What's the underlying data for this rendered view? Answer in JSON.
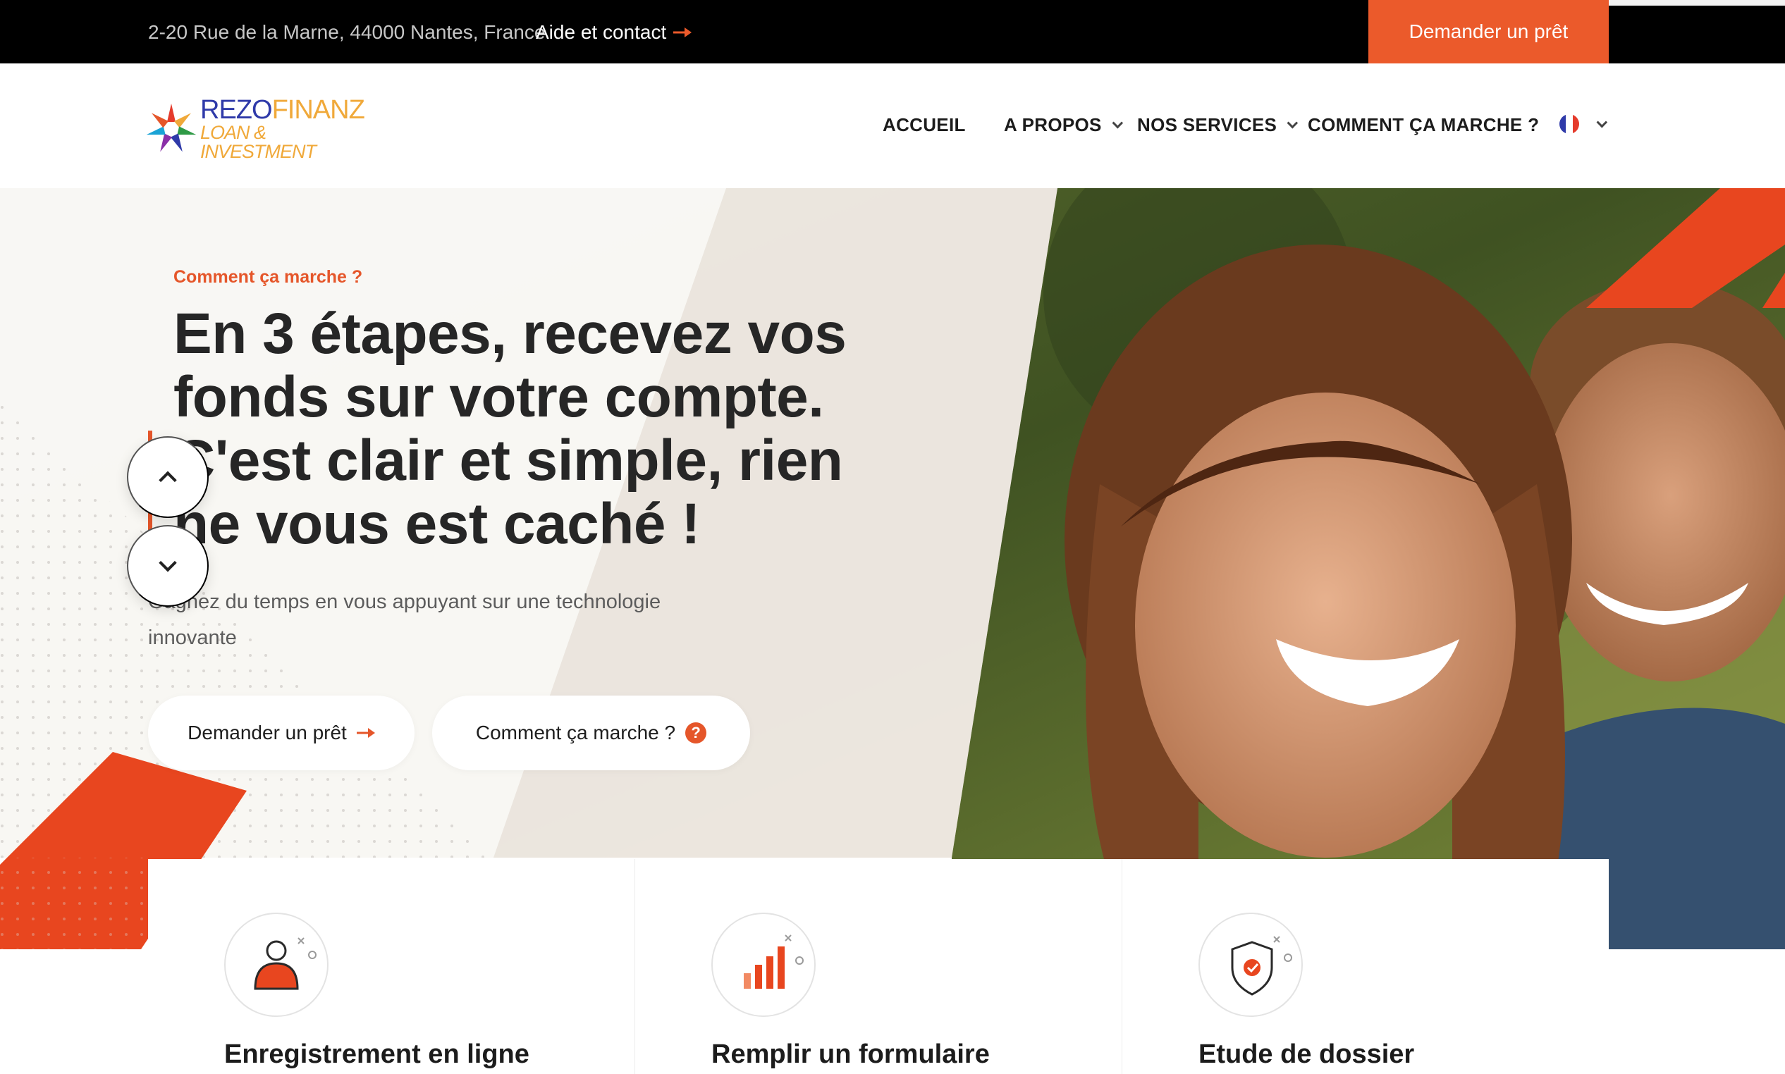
{
  "topbar": {
    "address": "2-20 Rue de la Marne, 44000 Nantes, France",
    "contact_label": "Aide et contact",
    "contact_icon": "arrow-right-icon",
    "cta_label": "Demander un prêt"
  },
  "brand": {
    "name_part1": "REZO",
    "name_part2": "FINANZ",
    "tagline": "LOAN & INVESTMENT",
    "colors": {
      "blue": "#2f3aa9",
      "gold": "#f0a93a"
    }
  },
  "nav": {
    "items": [
      {
        "label": "ACCUEIL",
        "has_dropdown": false
      },
      {
        "label": "A PROPOS",
        "has_dropdown": true
      },
      {
        "label": "NOS SERVICES",
        "has_dropdown": true
      },
      {
        "label": "COMMENT ÇA MARCHE ?",
        "has_dropdown": false
      }
    ],
    "language_icon": "france-flag-icon"
  },
  "hero": {
    "kicker": "Comment ça marche ?",
    "title": "En 3 étapes, recevez vos fonds sur votre compte. C'est clair et simple, rien ne vous est caché !",
    "subtitle": "Gagnez du temps en vous appuyant sur une technologie innovante",
    "buttons": {
      "loan_label": "Demander un prêt",
      "how_label": "Comment ça marche ?"
    }
  },
  "steps": [
    {
      "title": "Enregistrement en ligne",
      "icon": "user-icon"
    },
    {
      "title": "Remplir un formulaire",
      "icon": "bar-chart-icon"
    },
    {
      "title": "Etude de dossier",
      "icon": "shield-check-icon"
    }
  ],
  "colors": {
    "accent": "#eb5a2b",
    "topbar": "#000000",
    "text_dark": "#262626"
  }
}
